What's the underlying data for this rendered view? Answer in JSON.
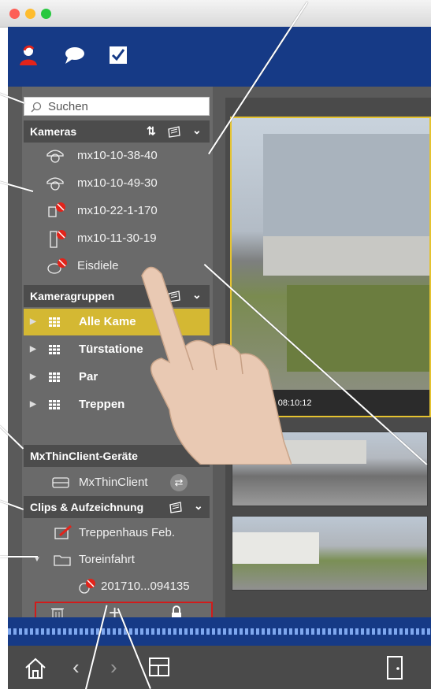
{
  "search": {
    "placeholder": "Suchen"
  },
  "sections": {
    "cameras": "Kameras",
    "camera_groups": "Kameragruppen",
    "thinclient": "MxThinClient-Geräte",
    "clips": "Clips & Aufzeichnung"
  },
  "cameras": [
    {
      "label": "mx10-10-38-40",
      "icon": "dome-camera-icon"
    },
    {
      "label": "mx10-10-49-30",
      "icon": "dome-camera-icon"
    },
    {
      "label": "mx10-22-1-170",
      "icon": "camera-offline-icon"
    },
    {
      "label": "mx10-11-30-19",
      "icon": "door-station-offline-icon"
    },
    {
      "label": "Eisdiele",
      "icon": "camera-offline-icon"
    }
  ],
  "camera_groups": [
    {
      "label": "Alle Kame",
      "selected": true
    },
    {
      "label": "Türstatione",
      "selected": false
    },
    {
      "label": "Par",
      "selected": false
    },
    {
      "label": "Treppen",
      "selected": false
    }
  ],
  "thinclients": [
    {
      "label": "MxThinClient"
    }
  ],
  "clips": [
    {
      "label": "Treppenhaus Feb.",
      "icon": "clip-edit-icon"
    },
    {
      "label": "Toreinfahrt",
      "icon": "folder-icon"
    },
    {
      "label": "201710...094135",
      "icon": "recording-offline-icon"
    }
  ],
  "viewer": {
    "timestamp": "- 08:10:12"
  },
  "colors": {
    "header_blue": "#163a86",
    "selection_yellow": "#d4b833",
    "highlight_red": "#d11b1b"
  }
}
